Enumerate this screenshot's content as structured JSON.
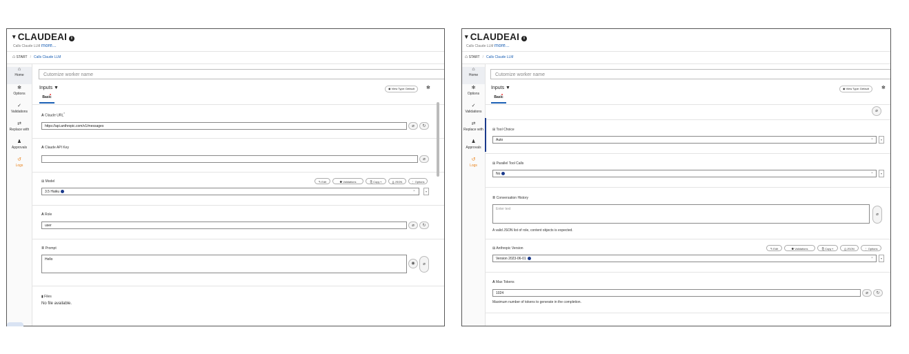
{
  "panels": [
    {
      "title": "CLAUDEAI",
      "subtitle": "Calls Claude LLM",
      "more": "more...",
      "breadcrumb": {
        "start": "START",
        "current": "Calls Claude LLM"
      },
      "nav": [
        "Home",
        "Options",
        "Validations",
        "Replace with",
        "Approvals",
        "Logs"
      ],
      "name_placeholder": "Cutomize worker name",
      "inputs_label": "Inputs",
      "tab": "Basic",
      "view_type": "View Type: Default",
      "claude_url": {
        "label": "Claude URL",
        "required": "*",
        "value": "https://api.anthropic.com/v1/messages"
      },
      "api_key": {
        "label": "Claude API Key",
        "value": ""
      },
      "model": {
        "label": "Model",
        "value": "3.5 Haiku"
      },
      "role": {
        "label": "Role",
        "value": "user"
      },
      "prompt": {
        "label": "Prompt",
        "value": "Hello"
      },
      "files": {
        "label": "Files",
        "empty": "No file available."
      },
      "toolbar": {
        "edit": "Edit",
        "validations": "Validations",
        "copy": "Copy",
        "json": "{} JSON",
        "options": "⋮ Options"
      }
    },
    {
      "title": "CLAUDEAI",
      "subtitle": "Calls Claude LLM",
      "more": "more...",
      "breadcrumb": {
        "start": "START",
        "current": "Calls Claude LLM"
      },
      "nav": [
        "Home",
        "Options",
        "Validations",
        "Replace with",
        "Approvals",
        "Logs"
      ],
      "name_placeholder": "Cutomize worker name",
      "inputs_label": "Inputs",
      "tab": "Basic",
      "view_type": "View Type: Default",
      "tool_choice": {
        "label": "Tool Choice",
        "value": "Auto"
      },
      "parallel_tool_calls": {
        "label": "Parallel Tool Calls",
        "value": "No"
      },
      "conversation_history": {
        "label": "Conversation History",
        "placeholder": "Enter text",
        "hint": "A valid JSON list of role, content objects is expected."
      },
      "anthropic_version": {
        "label": "Anthropic Version",
        "value": "Version 2023-06-01"
      },
      "max_tokens": {
        "label": "Max Tokens",
        "value": "1024",
        "hint": "Maximum number of tokens to generate in the completion."
      },
      "toolbar": {
        "edit": "Edit",
        "validations": "Validations",
        "copy": "Copy",
        "json": "{} JSON",
        "options": "⋮ Options"
      }
    }
  ],
  "icons": {
    "home": "home-icon",
    "options": "gear-icon",
    "validations": "validations-icon",
    "replace": "swap-icon",
    "approvals": "user-check-icon",
    "logs": "history-icon"
  },
  "colors": {
    "link": "#1a5fb4",
    "logs": "#e8821a",
    "badge": "#1a3a8c"
  }
}
